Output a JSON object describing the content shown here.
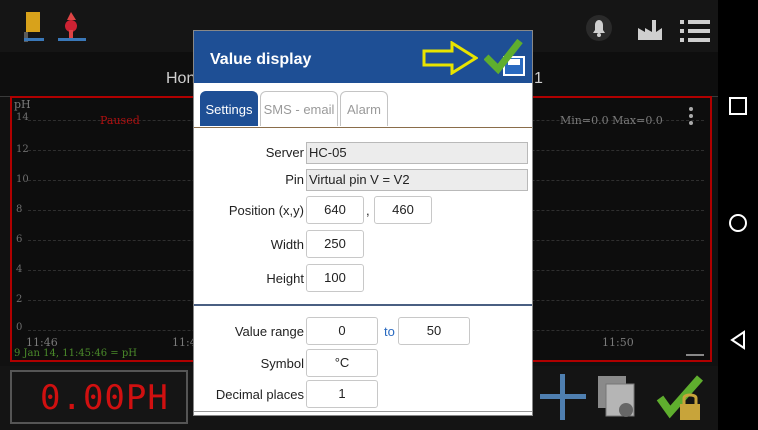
{
  "app": {
    "title_fragment_left": "Hon",
    "title_fragment_right": "1"
  },
  "chart": {
    "y_axis_title": "pH",
    "y_ticks": [
      "14",
      "12",
      "10",
      "8",
      "6",
      "4",
      "2",
      "0"
    ],
    "status": "Paused",
    "minmax": "Min=0.0  Max=0.0",
    "x_tick_left": "11:46",
    "x_tick_mid": "11:4",
    "x_tick_right": "11:50",
    "footer": "9 Jan 14, 11:45:46 = pH"
  },
  "display": {
    "reading": "0.00PH"
  },
  "dialog": {
    "title": "Value display",
    "tabs": [
      {
        "label": "Settings",
        "active": true
      },
      {
        "label": "SMS - email",
        "active": false
      },
      {
        "label": "Alarm",
        "active": false
      }
    ],
    "server_label": "Server",
    "server_value": "HC-05",
    "pin_label": "Pin",
    "pin_value": "Virtual pin V = V2",
    "position_label": "Position (x,y)",
    "position_x": "640",
    "position_comma": ",",
    "position_y": "460",
    "width_label": "Width",
    "width_value": "250",
    "height_label": "Height",
    "height_value": "100",
    "range_label": "Value range",
    "range_min": "0",
    "range_to": "to",
    "range_max": "50",
    "symbol_label": "Symbol",
    "symbol_value": "°C",
    "decimal_label": "Decimal places",
    "decimal_value": "1"
  },
  "colors": {
    "header_blue": "#1e4f95",
    "arrow_yellow": "#e8e400",
    "check_green": "#5fae2e",
    "lcd_red": "#d01010",
    "chart_border": "#b00000"
  },
  "icons": {
    "tank": "tank-icon",
    "valve": "valve-icon",
    "alarm": "bell-icon",
    "factory": "factory-icon",
    "menu": "menu-icon",
    "arrow": "arrow-right-icon",
    "save": "save-check-icon",
    "plus": "plus-icon",
    "copy": "copy-settings-icon",
    "lock": "lock-check-icon",
    "nav_square": "recent-apps-icon",
    "nav_circle": "home-icon",
    "nav_triangle": "back-icon",
    "more": "more-vert-icon"
  }
}
